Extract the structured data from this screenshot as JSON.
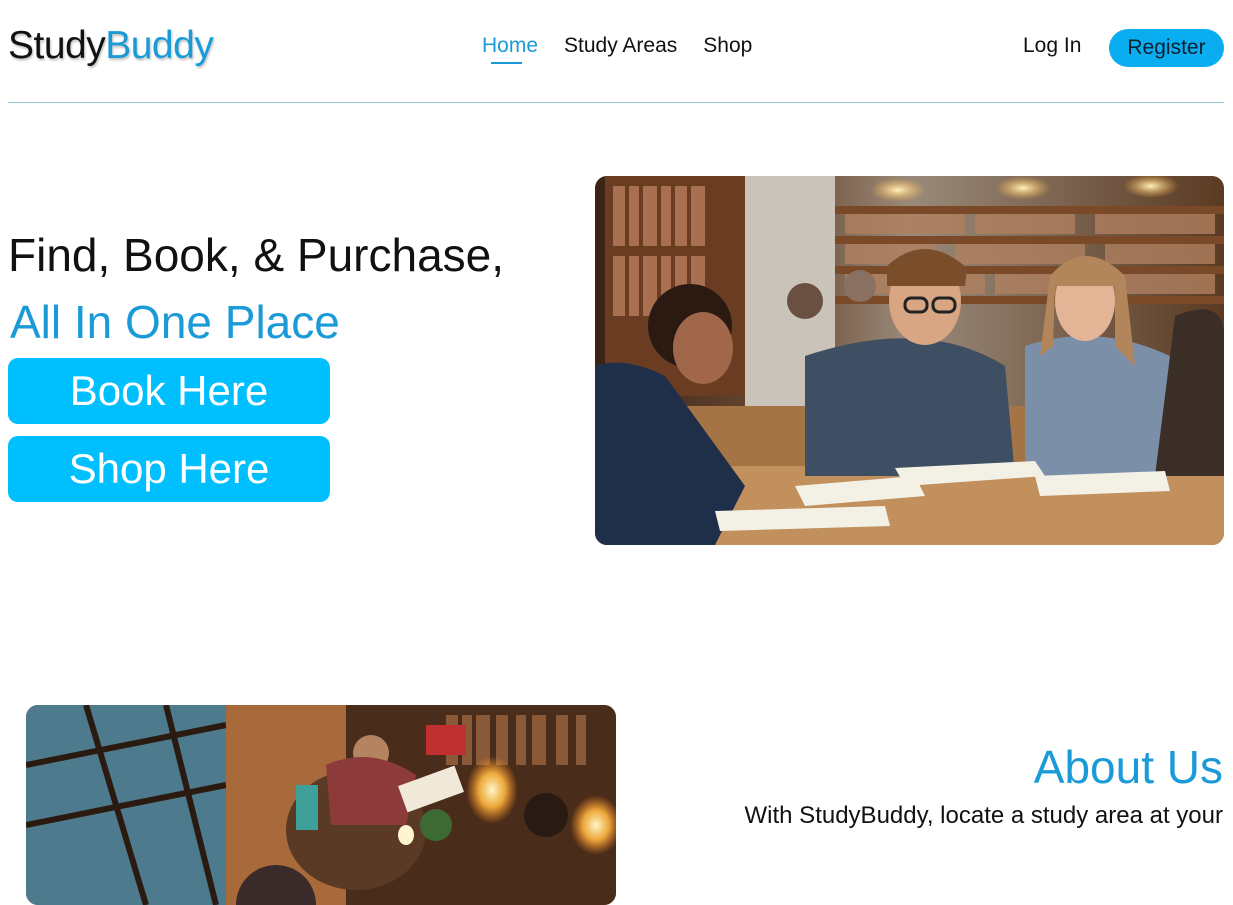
{
  "brand": {
    "part1": "Study",
    "part2": "Buddy"
  },
  "nav": {
    "items": [
      {
        "label": "Home",
        "active": true
      },
      {
        "label": "Study Areas",
        "active": false
      },
      {
        "label": "Shop",
        "active": false
      }
    ],
    "login_label": "Log In",
    "register_label": "Register"
  },
  "hero": {
    "headline": "Find, Book, & Purchase,",
    "subheadline": "All In One Place",
    "book_button": "Book Here",
    "shop_button": "Shop Here"
  },
  "about": {
    "title": "About Us",
    "text": "With StudyBuddy, locate a study area at your"
  },
  "colors": {
    "accent": "#1a9bd7",
    "button": "#00bfff",
    "register": "#0aaef0",
    "divider": "#9cc6d6"
  }
}
